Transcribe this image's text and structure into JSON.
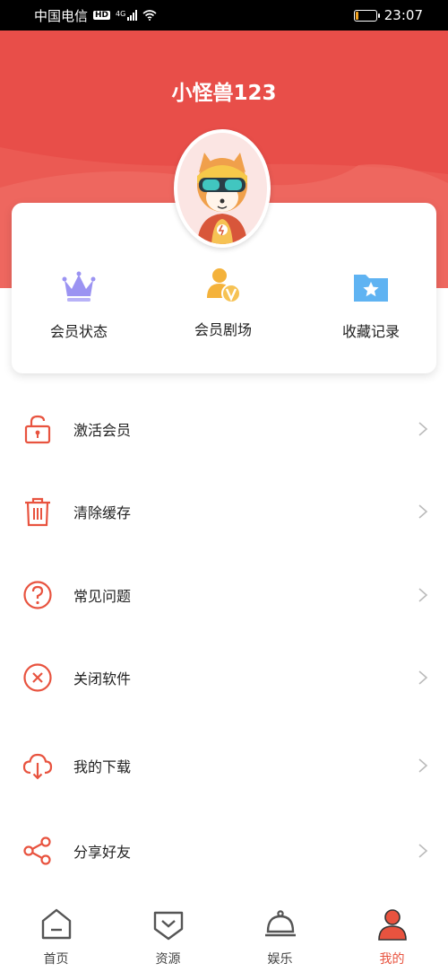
{
  "status_bar": {
    "carrier": "中国电信",
    "hd": "HD",
    "network": "4G",
    "time": "23:07",
    "battery_level": 0.15
  },
  "header": {
    "username": "小怪兽123"
  },
  "member_card": {
    "items": [
      {
        "label": "会员状态",
        "icon": "crown-icon",
        "color": "#9b93f2"
      },
      {
        "label": "会员剧场",
        "icon": "vip-user-icon",
        "color": "#f4b23b"
      },
      {
        "label": "收藏记录",
        "icon": "star-folder-icon",
        "color": "#5fb3f2"
      }
    ]
  },
  "menu": {
    "items": [
      {
        "label": "激活会员",
        "icon": "unlock-icon"
      },
      {
        "label": "清除缓存",
        "icon": "trash-icon"
      },
      {
        "label": "常见问题",
        "icon": "question-icon"
      },
      {
        "label": "关闭软件",
        "icon": "close-circle-icon"
      },
      {
        "label": "我的下载",
        "icon": "cloud-download-icon"
      },
      {
        "label": "分享好友",
        "icon": "share-icon"
      }
    ]
  },
  "tabbar": {
    "tabs": [
      {
        "label": "首页",
        "icon": "home-icon"
      },
      {
        "label": "资源",
        "icon": "resource-icon"
      },
      {
        "label": "娱乐",
        "icon": "cloche-icon"
      },
      {
        "label": "我的",
        "icon": "user-icon",
        "active": true
      }
    ]
  },
  "colors": {
    "header_red": "#e84e49",
    "accent": "#e8533f"
  }
}
